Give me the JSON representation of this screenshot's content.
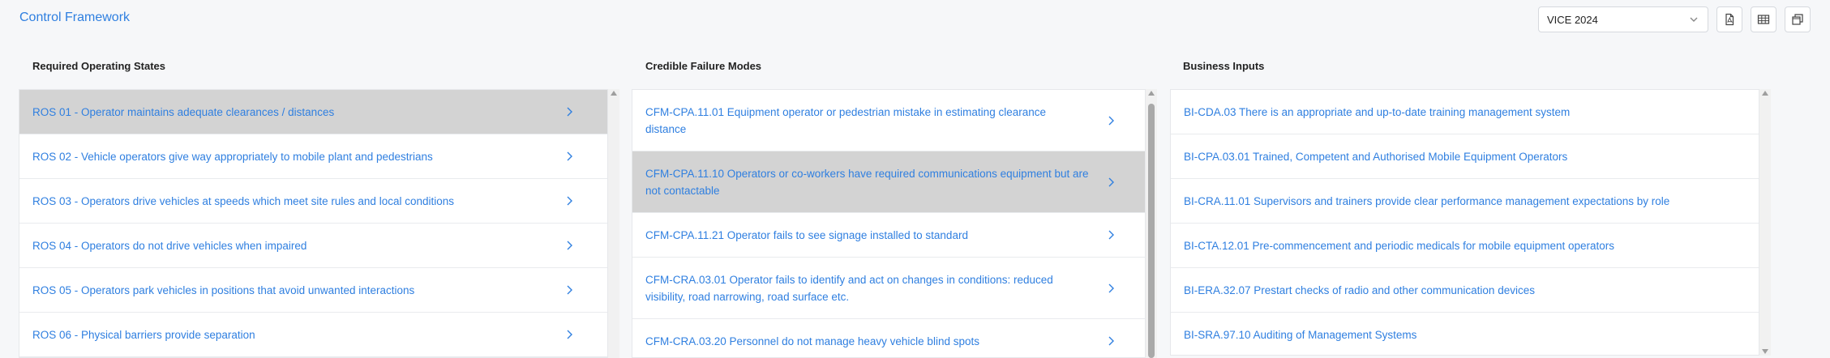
{
  "app": {
    "title": "Control Framework"
  },
  "toolbar": {
    "year_select": {
      "value": "VICE 2024"
    },
    "icons": [
      "pdf-export-icon",
      "table-view-icon",
      "window-restore-icon"
    ]
  },
  "columns": {
    "ros": {
      "header": "Required Operating States",
      "items": [
        {
          "label": "ROS 01 - Operator maintains adequate clearances / distances",
          "selected": true
        },
        {
          "label": "ROS 02 - Vehicle operators give way appropriately to mobile plant and pedestrians"
        },
        {
          "label": "ROS 03 - Operators drive vehicles at speeds which meet site rules and local conditions"
        },
        {
          "label": "ROS 04 - Operators do not drive vehicles when impaired"
        },
        {
          "label": "ROS 05 - Operators park vehicles in positions that avoid unwanted interactions"
        },
        {
          "label": "ROS 06 - Physical barriers provide separation"
        }
      ]
    },
    "cfm": {
      "header": "Credible Failure Modes",
      "items": [
        {
          "label": "CFM-CPA.11.01 Equipment operator or pedestrian mistake in estimating clearance distance"
        },
        {
          "label": "CFM-CPA.11.10 Operators or co-workers have required communications equipment but are not contactable",
          "selected": true
        },
        {
          "label": "CFM-CPA.11.21 Operator fails to see signage installed to standard"
        },
        {
          "label": "CFM-CRA.03.01 Operator fails to identify and act on changes in conditions: reduced visibility, road narrowing, road surface etc."
        },
        {
          "label": "CFM-CRA.03.20 Personnel do not manage heavy vehicle blind spots"
        }
      ]
    },
    "bi": {
      "header": "Business Inputs",
      "items": [
        {
          "label": "BI-CDA.03 There is an appropriate and up-to-date training management system"
        },
        {
          "label": "BI-CPA.03.01 Trained, Competent and Authorised Mobile Equipment Operators"
        },
        {
          "label": "BI-CRA.11.01 Supervisors and trainers provide clear performance management expectations by role"
        },
        {
          "label": "BI-CTA.12.01 Pre-commencement and periodic medicals for mobile equipment operators"
        },
        {
          "label": "BI-ERA.32.07 Prestart checks of radio and other communication devices"
        },
        {
          "label": "BI-SRA.97.10 Auditing of Management Systems"
        }
      ]
    }
  }
}
